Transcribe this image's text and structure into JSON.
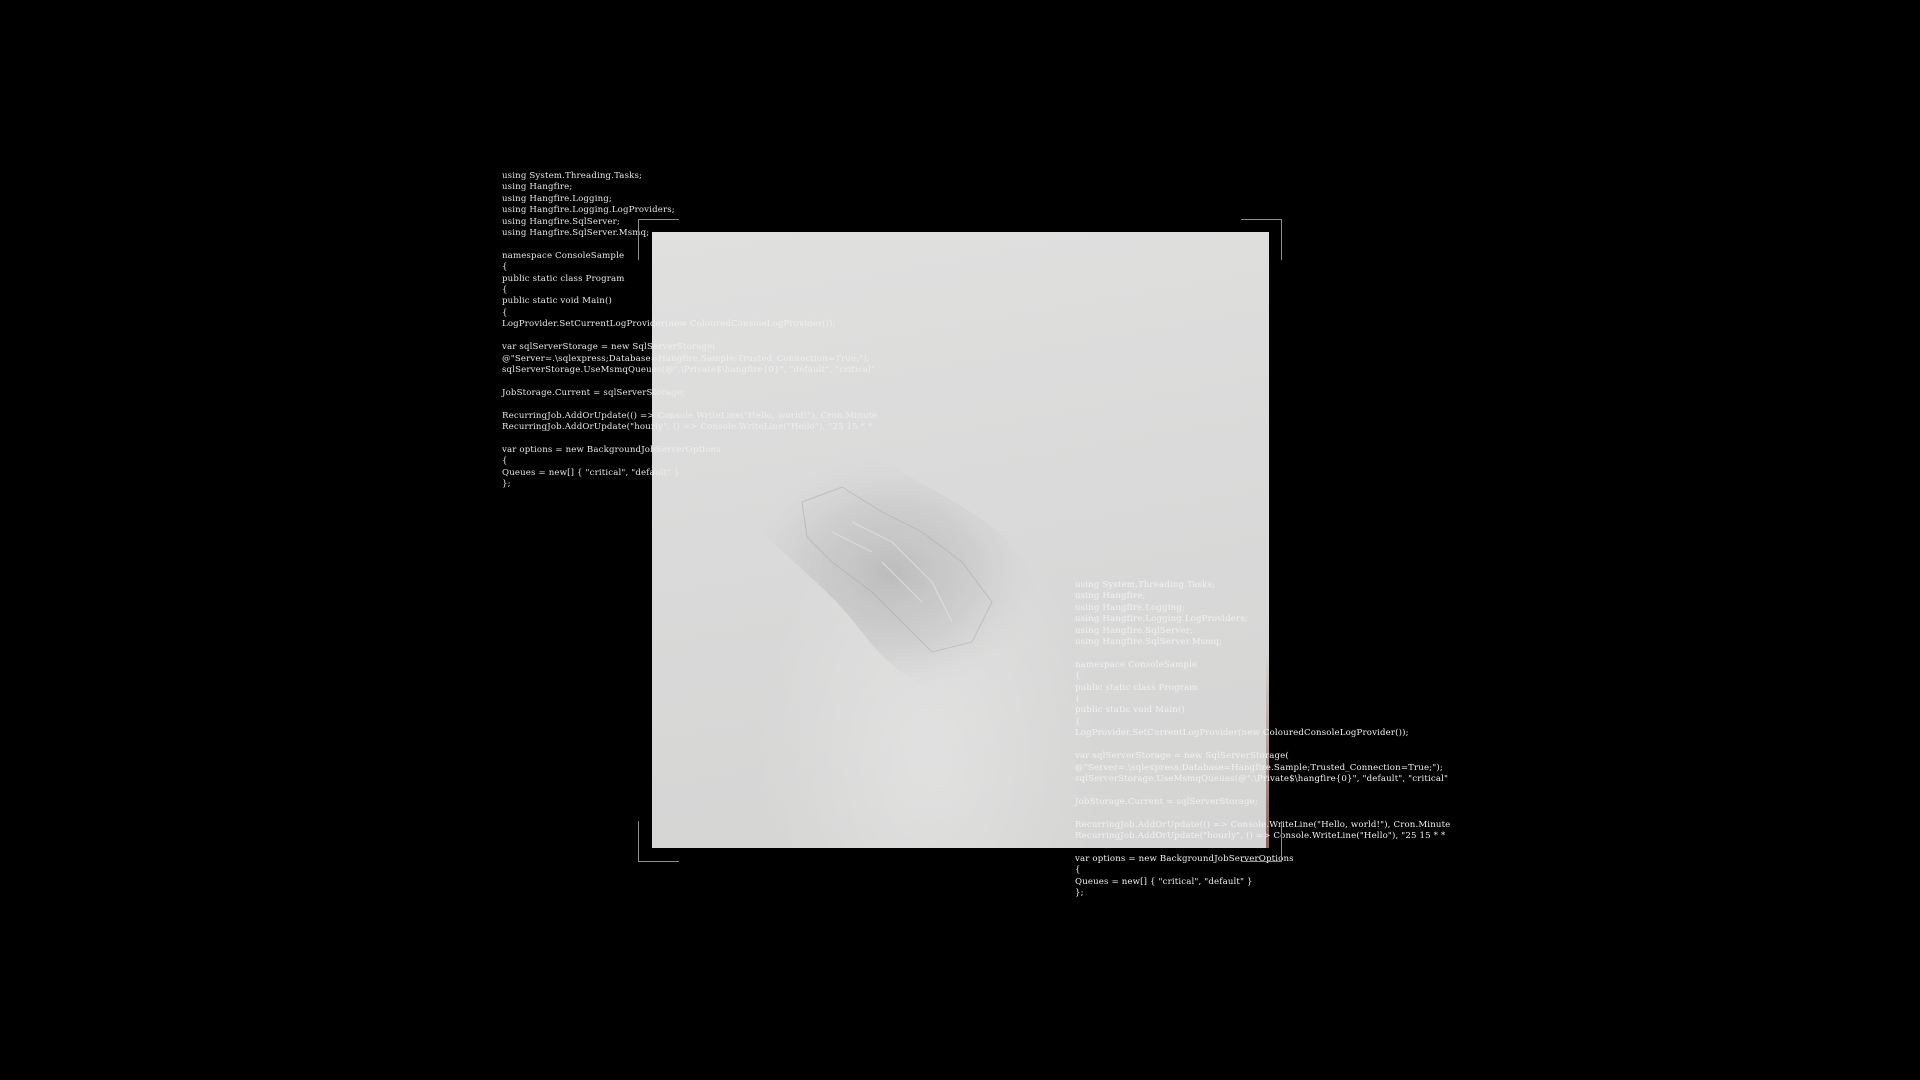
{
  "code_left": {
    "lines": [
      "using System.Threading.Tasks;",
      "using Hangfire;",
      "using Hangfire.Logging;",
      "using Hangfire.Logging.LogProviders;",
      "using Hangfire.SqlServer;",
      "using Hangfire.SqlServer.Msmq;",
      "",
      "namespace ConsoleSample",
      "{",
      "public static class Program",
      "{",
      "public static void Main()",
      "{",
      "LogProvider.SetCurrentLogProvider(new ColouredConsoleLogProvider());",
      "",
      "var sqlServerStorage = new SqlServerStorage(",
      "@\"Server=.\\sqlexpress;Database=Hangfire.Sample;Trusted_Connection=True;\");",
      "sqlServerStorage.UseMsmqQueues(@\".\\Private$\\hangfire{0}\", \"default\", \"critical\"",
      "",
      "JobStorage.Current = sqlServerStorage;",
      "",
      "RecurringJob.AddOrUpdate(() => Console.WriteLine(\"Hello, world!\"), Cron.Minute",
      "RecurringJob.AddOrUpdate(\"hourly\", () => Console.WriteLine(\"Hello\"), \"25 15 * *",
      "",
      "var options = new BackgroundJobServerOptions",
      "{",
      "Queues = new[] { \"critical\", \"default\" }",
      "};"
    ]
  },
  "code_right": {
    "lines": [
      "using System.Threading.Tasks;",
      "using Hangfire;",
      "using Hangfire.Logging;",
      "using Hangfire.Logging.LogProviders;",
      "using Hangfire.SqlServer;",
      "using Hangfire.SqlServer.Msmq;",
      "",
      "namespace ConsoleSample",
      "{",
      "public static class Program",
      "{",
      "public static void Main()",
      "{",
      "LogProvider.SetCurrentLogProvider(new ColouredConsoleLogProvider());",
      "",
      "var sqlServerStorage = new SqlServerStorage(",
      "@\"Server=.\\sqlexpress;Database=Hangfire.Sample;Trusted_Connection=True;\");",
      "sqlServerStorage.UseMsmqQueues(@\".\\Private$\\hangfire{0}\", \"default\", \"critical\"",
      "",
      "JobStorage.Current = sqlServerStorage;",
      "",
      "RecurringJob.AddOrUpdate(() => Console.WriteLine(\"Hello, world!\"), Cron.Minute",
      "RecurringJob.AddOrUpdate(\"hourly\", () => Console.WriteLine(\"Hello\"), \"25 15 * *",
      "",
      "var options = new BackgroundJobServerOptions",
      "{",
      "Queues = new[] { \"critical\", \"default\" }",
      "};"
    ]
  },
  "colors": {
    "background": "#000000",
    "code_text": "#e8e8e8",
    "photo_panel": "#eeeeed",
    "corner_marks": "#8d8d8d"
  },
  "icons": {
    "photo_content": "crystal-icon"
  }
}
